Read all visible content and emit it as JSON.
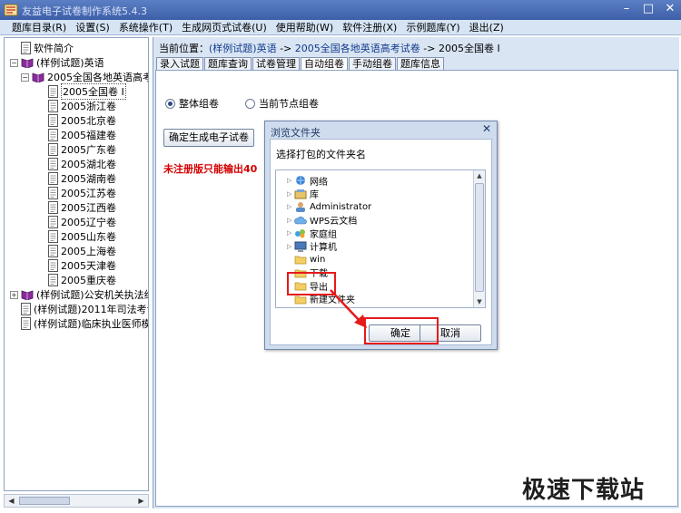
{
  "window": {
    "title": "友益电子试卷制作系统5.4.3",
    "minimize": "–",
    "maximize": "□",
    "close": "✕"
  },
  "menu": [
    "题库目录(R)",
    "设置(S)",
    "系统操作(T)",
    "生成网页式试卷(U)",
    "使用帮助(W)",
    "软件注册(X)",
    "示例题库(Y)",
    "退出(Z)"
  ],
  "tree": {
    "items": [
      {
        "label": "软件简介",
        "icon": "document-icon",
        "level": 0
      },
      {
        "label": "(样例试题)英语",
        "icon": "book-icon",
        "level": 0,
        "expander": "−"
      },
      {
        "label": "2005全国各地英语高考试",
        "icon": "book-icon",
        "level": 1,
        "expander": "−"
      },
      {
        "label": "2005全国卷 I",
        "icon": "document-icon",
        "level": 2,
        "selected": true
      },
      {
        "label": "2005浙江卷",
        "icon": "document-icon",
        "level": 2
      },
      {
        "label": "2005北京卷",
        "icon": "document-icon",
        "level": 2
      },
      {
        "label": "2005福建卷",
        "icon": "document-icon",
        "level": 2
      },
      {
        "label": "2005广东卷",
        "icon": "document-icon",
        "level": 2
      },
      {
        "label": "2005湖北卷",
        "icon": "document-icon",
        "level": 2
      },
      {
        "label": "2005湖南卷",
        "icon": "document-icon",
        "level": 2
      },
      {
        "label": "2005江苏卷",
        "icon": "document-icon",
        "level": 2
      },
      {
        "label": "2005江西卷",
        "icon": "document-icon",
        "level": 2
      },
      {
        "label": "2005辽宁卷",
        "icon": "document-icon",
        "level": 2
      },
      {
        "label": "2005山东卷",
        "icon": "document-icon",
        "level": 2
      },
      {
        "label": "2005上海卷",
        "icon": "document-icon",
        "level": 2
      },
      {
        "label": "2005天津卷",
        "icon": "document-icon",
        "level": 2
      },
      {
        "label": "2005重庆卷",
        "icon": "document-icon",
        "level": 2
      },
      {
        "label": "(样例试题)公安机关执法细",
        "icon": "book-icon",
        "level": 0,
        "expander": "+"
      },
      {
        "label": "(样例试题)2011年司法考试",
        "icon": "document-icon",
        "level": 0
      },
      {
        "label": "(样例试题)临床执业医师模",
        "icon": "document-icon",
        "level": 0
      }
    ],
    "scroll_left": "◀",
    "scroll_right": "▶"
  },
  "breadcrumb": {
    "prefix": "当前位置：",
    "part1": "(样例试题)英语",
    "sep1": " -> ",
    "part2": "2005全国各地英语高考试卷",
    "sep2": " -> ",
    "part3": "2005全国卷 I"
  },
  "tabs": [
    "录入试题",
    "题库查询",
    "试卷管理",
    "自动组卷",
    "手动组卷",
    "题库信息"
  ],
  "options": {
    "radio1": "整体组卷",
    "radio2": "当前节点组卷",
    "generate_button": "确定生成电子试卷",
    "warning": "未注册版只能输出40"
  },
  "dialog": {
    "title": "浏览文件夹",
    "close": "✕",
    "prompt": "选择打包的文件夹名",
    "folders": [
      {
        "label": "网络",
        "icon": "network-icon",
        "expander": "▷"
      },
      {
        "label": "库",
        "icon": "library-icon",
        "expander": "▷"
      },
      {
        "label": "Administrator",
        "icon": "user-icon",
        "expander": "▷"
      },
      {
        "label": "WPS云文档",
        "icon": "cloud-icon",
        "expander": "▷"
      },
      {
        "label": "家庭组",
        "icon": "homegroup-icon",
        "expander": "▷"
      },
      {
        "label": "计算机",
        "icon": "computer-icon",
        "expander": "▷"
      },
      {
        "label": "win",
        "icon": "folder-icon",
        "expander": ""
      },
      {
        "label": "下载",
        "icon": "folder-icon",
        "expander": ""
      },
      {
        "label": "导出",
        "icon": "folder-icon",
        "expander": "",
        "selected": true
      },
      {
        "label": "新建文件夹",
        "icon": "folder-icon",
        "expander": ""
      }
    ],
    "ok": "确定",
    "cancel": "取消"
  },
  "watermark": "极速下载站",
  "colors": {
    "annotation_red": "#e41b1b",
    "warning_red": "#d40000",
    "title_blue": "#3d5fa8"
  }
}
